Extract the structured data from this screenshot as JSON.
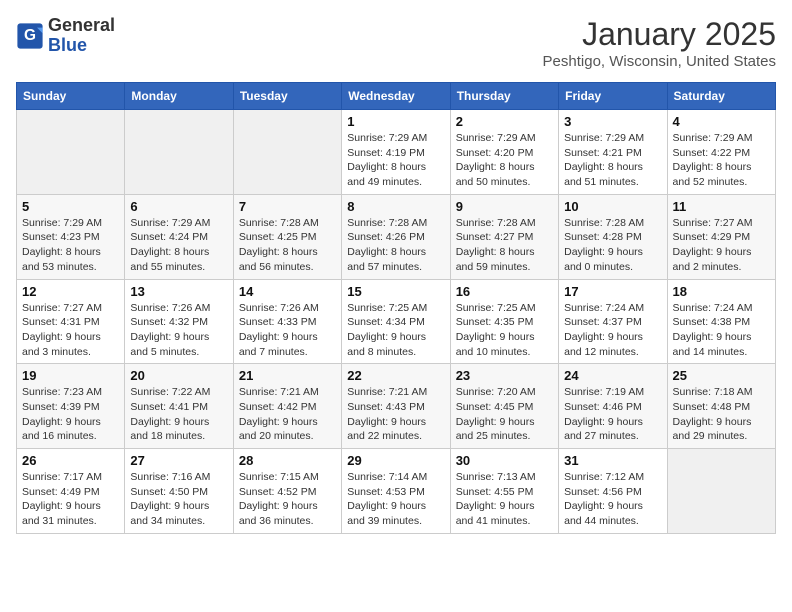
{
  "header": {
    "logo_general": "General",
    "logo_blue": "Blue",
    "month_title": "January 2025",
    "location": "Peshtigo, Wisconsin, United States"
  },
  "weekdays": [
    "Sunday",
    "Monday",
    "Tuesday",
    "Wednesday",
    "Thursday",
    "Friday",
    "Saturday"
  ],
  "weeks": [
    [
      {
        "day": "",
        "sunrise": "",
        "sunset": "",
        "daylight": ""
      },
      {
        "day": "",
        "sunrise": "",
        "sunset": "",
        "daylight": ""
      },
      {
        "day": "",
        "sunrise": "",
        "sunset": "",
        "daylight": ""
      },
      {
        "day": "1",
        "sunrise": "Sunrise: 7:29 AM",
        "sunset": "Sunset: 4:19 PM",
        "daylight": "Daylight: 8 hours and 49 minutes."
      },
      {
        "day": "2",
        "sunrise": "Sunrise: 7:29 AM",
        "sunset": "Sunset: 4:20 PM",
        "daylight": "Daylight: 8 hours and 50 minutes."
      },
      {
        "day": "3",
        "sunrise": "Sunrise: 7:29 AM",
        "sunset": "Sunset: 4:21 PM",
        "daylight": "Daylight: 8 hours and 51 minutes."
      },
      {
        "day": "4",
        "sunrise": "Sunrise: 7:29 AM",
        "sunset": "Sunset: 4:22 PM",
        "daylight": "Daylight: 8 hours and 52 minutes."
      }
    ],
    [
      {
        "day": "5",
        "sunrise": "Sunrise: 7:29 AM",
        "sunset": "Sunset: 4:23 PM",
        "daylight": "Daylight: 8 hours and 53 minutes."
      },
      {
        "day": "6",
        "sunrise": "Sunrise: 7:29 AM",
        "sunset": "Sunset: 4:24 PM",
        "daylight": "Daylight: 8 hours and 55 minutes."
      },
      {
        "day": "7",
        "sunrise": "Sunrise: 7:28 AM",
        "sunset": "Sunset: 4:25 PM",
        "daylight": "Daylight: 8 hours and 56 minutes."
      },
      {
        "day": "8",
        "sunrise": "Sunrise: 7:28 AM",
        "sunset": "Sunset: 4:26 PM",
        "daylight": "Daylight: 8 hours and 57 minutes."
      },
      {
        "day": "9",
        "sunrise": "Sunrise: 7:28 AM",
        "sunset": "Sunset: 4:27 PM",
        "daylight": "Daylight: 8 hours and 59 minutes."
      },
      {
        "day": "10",
        "sunrise": "Sunrise: 7:28 AM",
        "sunset": "Sunset: 4:28 PM",
        "daylight": "Daylight: 9 hours and 0 minutes."
      },
      {
        "day": "11",
        "sunrise": "Sunrise: 7:27 AM",
        "sunset": "Sunset: 4:29 PM",
        "daylight": "Daylight: 9 hours and 2 minutes."
      }
    ],
    [
      {
        "day": "12",
        "sunrise": "Sunrise: 7:27 AM",
        "sunset": "Sunset: 4:31 PM",
        "daylight": "Daylight: 9 hours and 3 minutes."
      },
      {
        "day": "13",
        "sunrise": "Sunrise: 7:26 AM",
        "sunset": "Sunset: 4:32 PM",
        "daylight": "Daylight: 9 hours and 5 minutes."
      },
      {
        "day": "14",
        "sunrise": "Sunrise: 7:26 AM",
        "sunset": "Sunset: 4:33 PM",
        "daylight": "Daylight: 9 hours and 7 minutes."
      },
      {
        "day": "15",
        "sunrise": "Sunrise: 7:25 AM",
        "sunset": "Sunset: 4:34 PM",
        "daylight": "Daylight: 9 hours and 8 minutes."
      },
      {
        "day": "16",
        "sunrise": "Sunrise: 7:25 AM",
        "sunset": "Sunset: 4:35 PM",
        "daylight": "Daylight: 9 hours and 10 minutes."
      },
      {
        "day": "17",
        "sunrise": "Sunrise: 7:24 AM",
        "sunset": "Sunset: 4:37 PM",
        "daylight": "Daylight: 9 hours and 12 minutes."
      },
      {
        "day": "18",
        "sunrise": "Sunrise: 7:24 AM",
        "sunset": "Sunset: 4:38 PM",
        "daylight": "Daylight: 9 hours and 14 minutes."
      }
    ],
    [
      {
        "day": "19",
        "sunrise": "Sunrise: 7:23 AM",
        "sunset": "Sunset: 4:39 PM",
        "daylight": "Daylight: 9 hours and 16 minutes."
      },
      {
        "day": "20",
        "sunrise": "Sunrise: 7:22 AM",
        "sunset": "Sunset: 4:41 PM",
        "daylight": "Daylight: 9 hours and 18 minutes."
      },
      {
        "day": "21",
        "sunrise": "Sunrise: 7:21 AM",
        "sunset": "Sunset: 4:42 PM",
        "daylight": "Daylight: 9 hours and 20 minutes."
      },
      {
        "day": "22",
        "sunrise": "Sunrise: 7:21 AM",
        "sunset": "Sunset: 4:43 PM",
        "daylight": "Daylight: 9 hours and 22 minutes."
      },
      {
        "day": "23",
        "sunrise": "Sunrise: 7:20 AM",
        "sunset": "Sunset: 4:45 PM",
        "daylight": "Daylight: 9 hours and 25 minutes."
      },
      {
        "day": "24",
        "sunrise": "Sunrise: 7:19 AM",
        "sunset": "Sunset: 4:46 PM",
        "daylight": "Daylight: 9 hours and 27 minutes."
      },
      {
        "day": "25",
        "sunrise": "Sunrise: 7:18 AM",
        "sunset": "Sunset: 4:48 PM",
        "daylight": "Daylight: 9 hours and 29 minutes."
      }
    ],
    [
      {
        "day": "26",
        "sunrise": "Sunrise: 7:17 AM",
        "sunset": "Sunset: 4:49 PM",
        "daylight": "Daylight: 9 hours and 31 minutes."
      },
      {
        "day": "27",
        "sunrise": "Sunrise: 7:16 AM",
        "sunset": "Sunset: 4:50 PM",
        "daylight": "Daylight: 9 hours and 34 minutes."
      },
      {
        "day": "28",
        "sunrise": "Sunrise: 7:15 AM",
        "sunset": "Sunset: 4:52 PM",
        "daylight": "Daylight: 9 hours and 36 minutes."
      },
      {
        "day": "29",
        "sunrise": "Sunrise: 7:14 AM",
        "sunset": "Sunset: 4:53 PM",
        "daylight": "Daylight: 9 hours and 39 minutes."
      },
      {
        "day": "30",
        "sunrise": "Sunrise: 7:13 AM",
        "sunset": "Sunset: 4:55 PM",
        "daylight": "Daylight: 9 hours and 41 minutes."
      },
      {
        "day": "31",
        "sunrise": "Sunrise: 7:12 AM",
        "sunset": "Sunset: 4:56 PM",
        "daylight": "Daylight: 9 hours and 44 minutes."
      },
      {
        "day": "",
        "sunrise": "",
        "sunset": "",
        "daylight": ""
      }
    ]
  ]
}
